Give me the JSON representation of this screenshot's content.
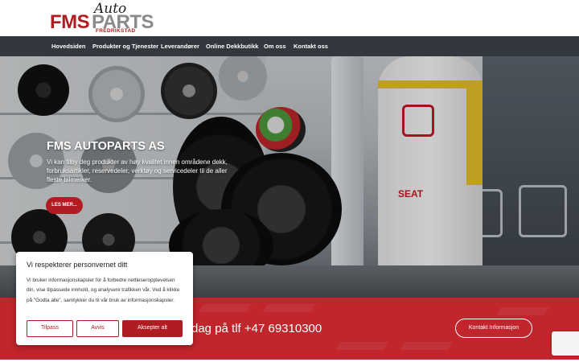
{
  "logo": {
    "brand_part1": "FMS",
    "brand_part2": "PARTS",
    "script_word": "Auto",
    "location": "FREDRIKSTAD"
  },
  "nav": {
    "items": [
      {
        "label": "Hovedsiden"
      },
      {
        "label": "Produkter og Tjenester"
      },
      {
        "label": "Leverandører"
      },
      {
        "label": "Online Dekkbutikk"
      },
      {
        "label": "Om oss"
      },
      {
        "label": "Kontakt oss"
      }
    ]
  },
  "hero": {
    "title": "FMS AUTOPARTS AS",
    "text": "Vi kan tilby deg produkter av høy kvalitet innen områdene dekk, forbruksartikler, reservedeler, verktøy og servicedeler til de aller fleste bilmerker.",
    "button_label": "LES MER..."
  },
  "band": {
    "text": "dag på tlf +47 69310300",
    "button_label": "Kontakt Informasjon"
  },
  "cookie": {
    "title": "Vi respekterer personvernet ditt",
    "text": "Vi bruker informasjonskapsler for å forbedre nettleseropplevelsen din, vise tilpassede innhold, og analysere trafikken vår. Ved å klikke på \"Godta alle\", samtykker du til vår bruk av informasjonskapsler.",
    "customize_label": "Tilpass",
    "reject_label": "Avvis",
    "accept_label": "Aksepter alt"
  },
  "hero_image": {
    "suit_text": "SEAT"
  },
  "colors": {
    "brand_red": "#b01c21",
    "nav_bg": "#32383e",
    "band_red": "#c0262c"
  }
}
